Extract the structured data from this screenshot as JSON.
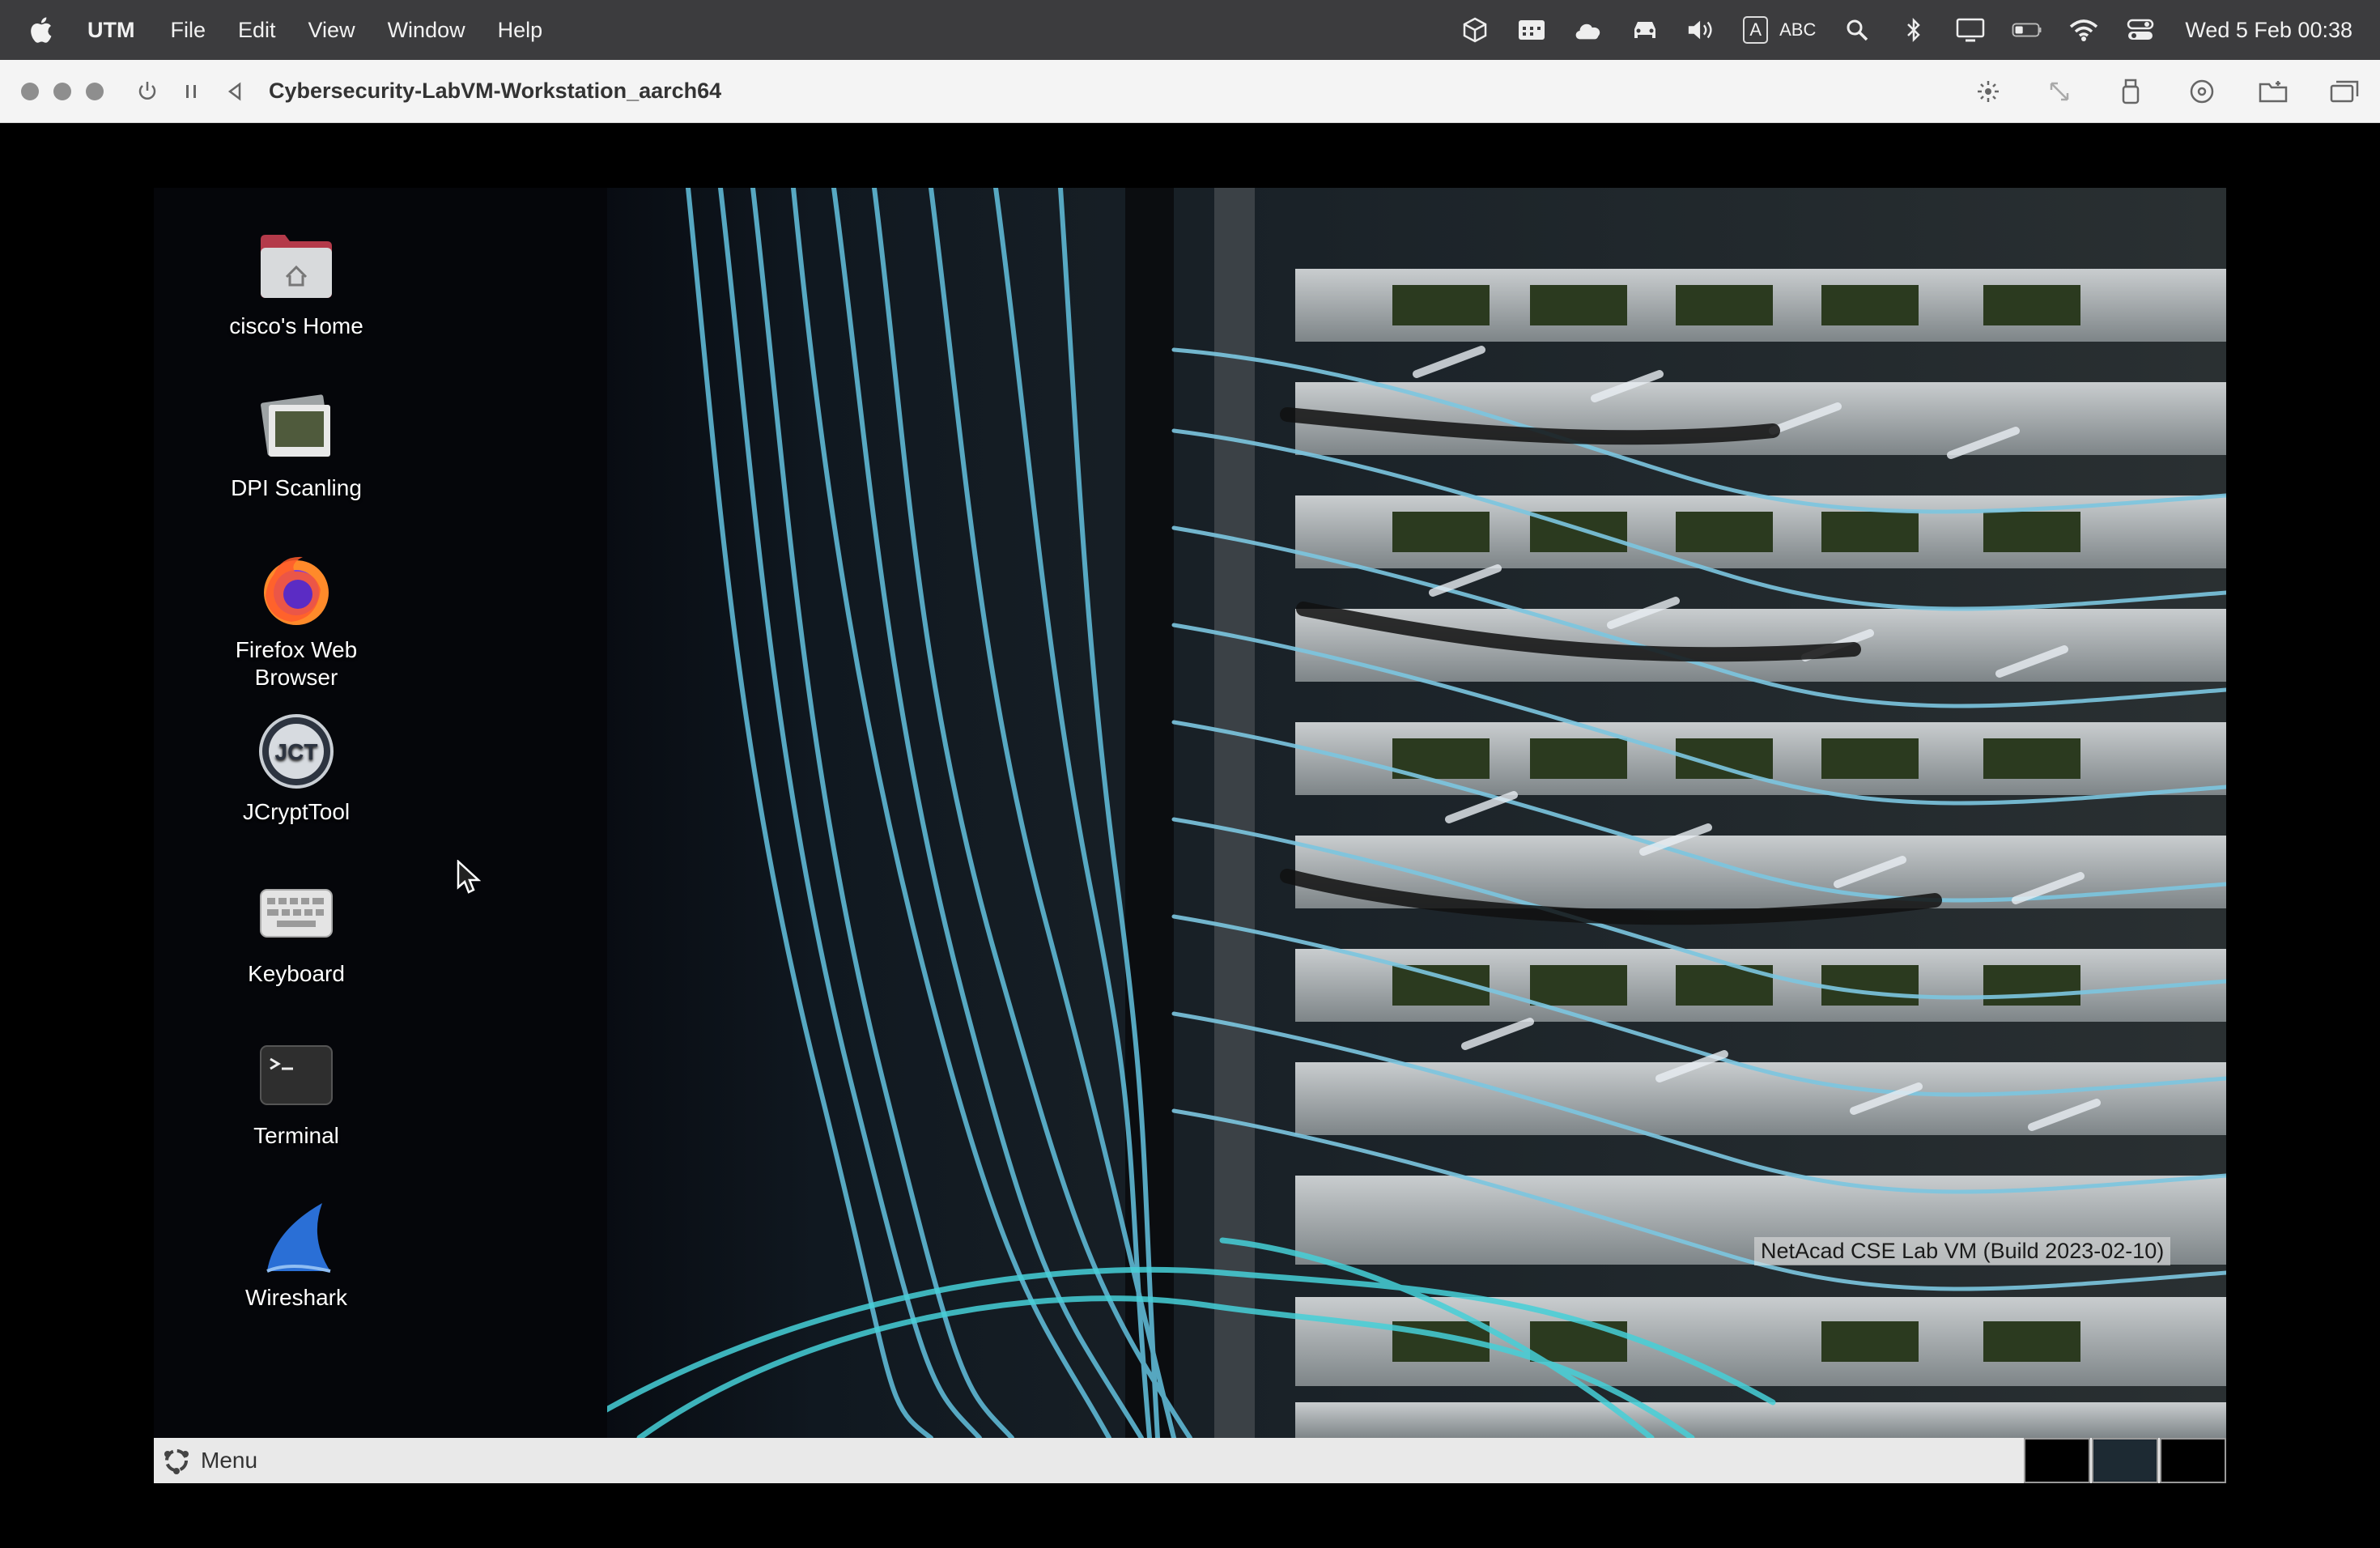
{
  "menubar": {
    "app_name": "UTM",
    "menus": [
      "File",
      "Edit",
      "View",
      "Window",
      "Help"
    ],
    "input_source_letter": "A",
    "input_source_label": "ABC",
    "clock": "Wed 5 Feb  00:38"
  },
  "window": {
    "title": "Cybersecurity-LabVM-Workstation_aarch64"
  },
  "desktop": {
    "icons": [
      {
        "label": "cisco's Home",
        "icon": "home-folder-icon"
      },
      {
        "label": "DPI Scanling",
        "icon": "display-settings-icon"
      },
      {
        "label": "Firefox Web Browser",
        "icon": "firefox-icon"
      },
      {
        "label": "JCryptTool",
        "icon": "jcrypttool-icon"
      },
      {
        "label": "Keyboard",
        "icon": "keyboard-icon"
      },
      {
        "label": "Terminal",
        "icon": "terminal-icon"
      },
      {
        "label": "Wireshark",
        "icon": "wireshark-icon"
      }
    ],
    "watermark": "NetAcad CSE Lab VM (Build 2023-02-10)"
  },
  "taskbar": {
    "menu_label": "Menu",
    "workspaces": 3,
    "active_workspace": 2
  }
}
